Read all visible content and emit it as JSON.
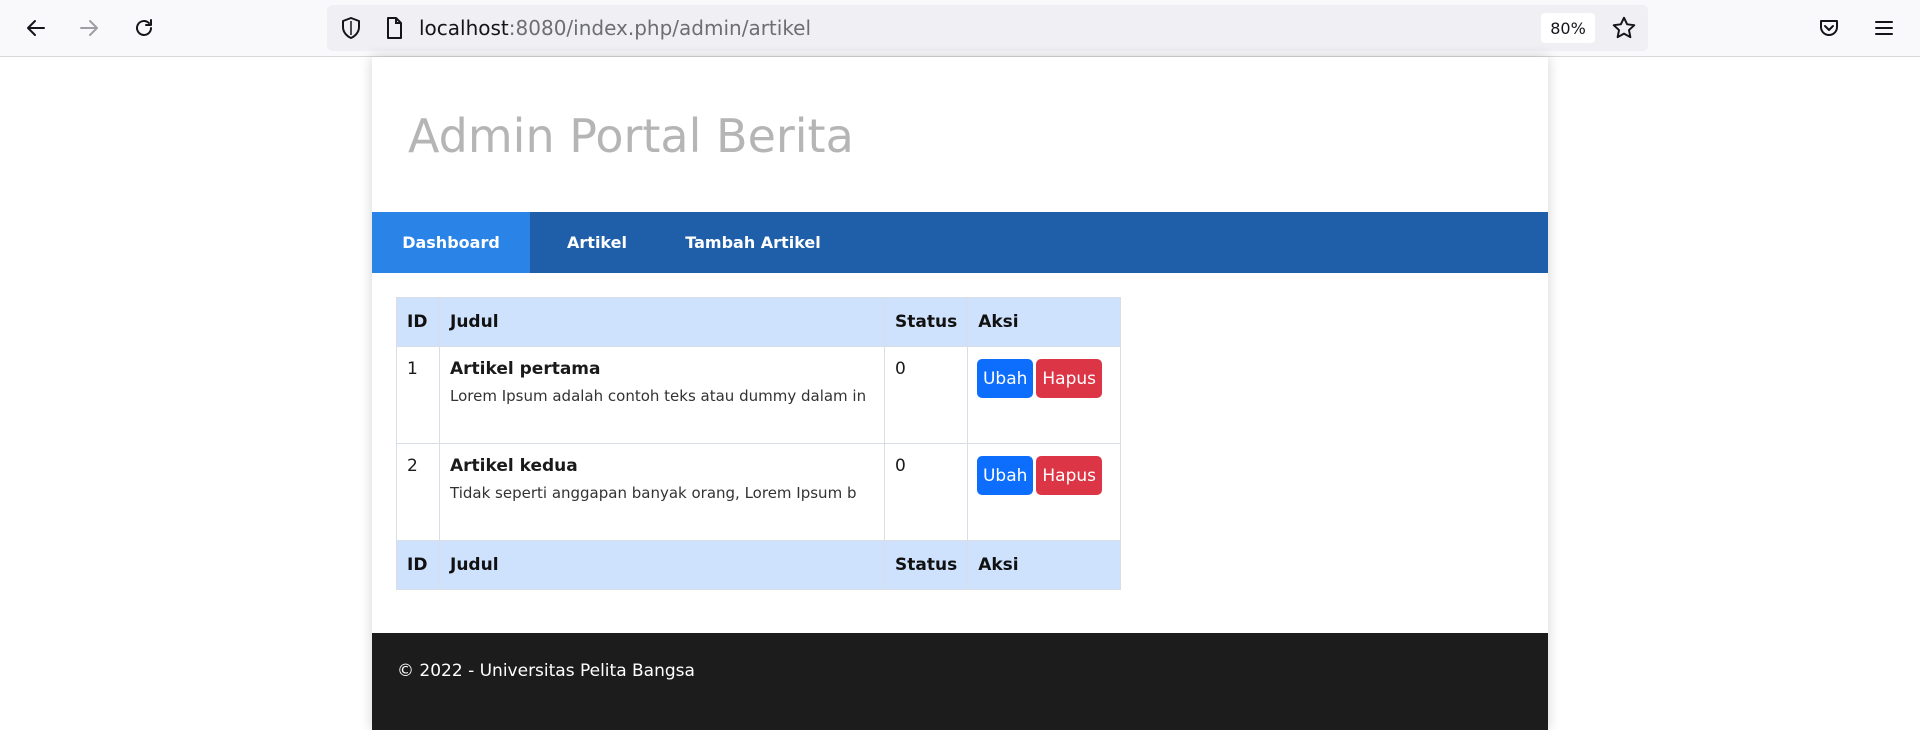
{
  "browser": {
    "url_host": "localhost",
    "url_path": ":8080/index.php/admin/artikel",
    "zoom": "80%",
    "icons": [
      "back-arrow-icon",
      "forward-arrow-icon",
      "reload-icon",
      "shield-icon",
      "page-icon",
      "star-icon",
      "pocket-icon",
      "menu-icon"
    ]
  },
  "site": {
    "title": "Admin Portal Berita"
  },
  "nav": {
    "items": [
      {
        "label": "Dashboard",
        "active": true
      },
      {
        "label": "Artikel",
        "active": false
      },
      {
        "label": "Tambah Artikel",
        "active": false
      }
    ]
  },
  "table": {
    "headers": [
      "ID",
      "Judul",
      "Status",
      "Aksi"
    ],
    "rows": [
      {
        "id": "1",
        "title": "Artikel pertama",
        "excerpt": "Lorem Ipsum adalah contoh teks atau dummy dalam in",
        "status": "0",
        "edit_label": "Ubah",
        "delete_label": "Hapus"
      },
      {
        "id": "2",
        "title": "Artikel kedua",
        "excerpt": "Tidak seperti anggapan banyak orang, Lorem Ipsum b",
        "status": "0",
        "edit_label": "Ubah",
        "delete_label": "Hapus"
      }
    ],
    "footers": [
      "ID",
      "Judul",
      "Status",
      "Aksi"
    ]
  },
  "footer": {
    "text": "© 2022 - Universitas Pelita Bangsa"
  },
  "colors": {
    "navbar": "#1f5fa9",
    "nav_active": "#2a83e6",
    "table_header": "#cfe2fd",
    "btn_edit": "#0d6efd",
    "btn_delete": "#dc3545",
    "footer_bg": "#1c1c1c"
  }
}
